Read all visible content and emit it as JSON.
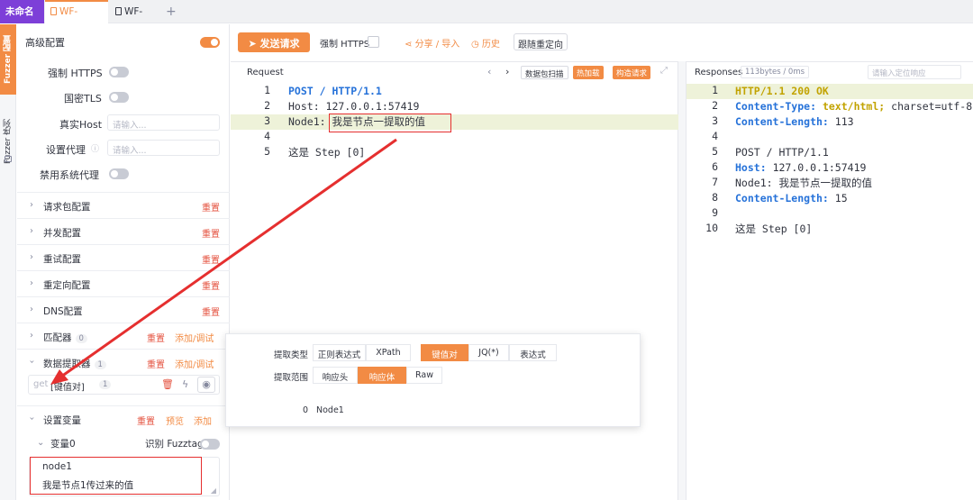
{
  "tabs": {
    "main_label": "未命名[0]",
    "wf1_label": "WF-[1]",
    "wf2_label": "WF-[2]",
    "add_label": "+"
  },
  "vertical_tabs": {
    "config_label": "Fuzzer 配置",
    "sequence_label": "Fuzzer 序列"
  },
  "config": {
    "advanced_label": "高级配置",
    "advanced_on": true,
    "force_https_label": "强制 HTTPS",
    "gm_tls_label": "国密TLS",
    "real_host_label": "真实Host",
    "real_host_placeholder": "请输入...",
    "proxy_label": "设置代理",
    "proxy_placeholder": "请输入...",
    "disable_proxy_label": "禁用系统代理",
    "sections": [
      {
        "name": "请求包配置",
        "reset": "重置"
      },
      {
        "name": "并发配置",
        "reset": "重置"
      },
      {
        "name": "重试配置",
        "reset": "重置"
      },
      {
        "name": "重定向配置",
        "reset": "重置"
      },
      {
        "name": "DNS配置",
        "reset": "重置"
      },
      {
        "name": "匹配器",
        "count": "0",
        "reset": "重置",
        "add": "添加/调试"
      },
      {
        "name": "数据提取器",
        "count": "1",
        "reset": "重置",
        "add": "添加/调试"
      }
    ],
    "extractor_item": {
      "prefix": "get",
      "name": "[键值对]",
      "count": "1"
    },
    "variables": {
      "name": "设置变量",
      "reset": "重置",
      "preview": "预览",
      "add": "添加",
      "var0_label": "变量0",
      "fuzztag_label": "识别 Fuzztag",
      "var_name": "node1",
      "var_value": "我是节点1传过来的值"
    }
  },
  "toolbar": {
    "send_label": "发送请求",
    "force_https_label": "强制 HTTPS",
    "share_label": "分享 / 导入",
    "history_label": "历史",
    "redirect_label": "跟随重定向"
  },
  "request": {
    "title": "Request",
    "btn_scan": "数据包扫描",
    "btn_hotload": "热加载",
    "btn_build": "构造请求",
    "lines": [
      {
        "n": "1",
        "text": "POST / HTTP/1.1"
      },
      {
        "n": "2",
        "text": "Host: 127.0.0.1:57419"
      },
      {
        "n": "3",
        "key": "Node1:",
        "value": "我是节点一提取的值"
      },
      {
        "n": "4",
        "text": ""
      },
      {
        "n": "5",
        "text": "这是 Step [0]"
      }
    ]
  },
  "response": {
    "title": "Responses",
    "meta": "113bytes / 0ms",
    "search_placeholder": "请输入定位响应",
    "lines": [
      {
        "n": "1",
        "text": "HTTP/1.1 200 OK"
      },
      {
        "n": "2",
        "key": "Content-Type:",
        "value": "text/html;",
        "rest": "charset=utf-8"
      },
      {
        "n": "3",
        "key": "Content-Length:",
        "value": "113"
      },
      {
        "n": "4",
        "text": ""
      },
      {
        "n": "5",
        "text": "POST / HTTP/1.1"
      },
      {
        "n": "6",
        "key": "Host:",
        "value": "127.0.0.1:57419"
      },
      {
        "n": "7",
        "text": "Node1: 我是节点一提取的值"
      },
      {
        "n": "8",
        "key": "Content-Length:",
        "value": "15"
      },
      {
        "n": "9",
        "text": ""
      },
      {
        "n": "10",
        "text": "这是 Step [0]"
      }
    ]
  },
  "popup": {
    "type_label": "提取类型",
    "types": [
      "正则表达式",
      "XPath",
      "键值对",
      "JQ(*)",
      "表达式"
    ],
    "active_type": "键值对",
    "scope_label": "提取范围",
    "scopes": [
      "响应头",
      "响应体",
      "Raw"
    ],
    "active_scope": "响应体",
    "result_index": "0",
    "result_value": "Node1"
  },
  "colors": {
    "accent": "#f28b44",
    "purple": "#7d3fd8",
    "annotation": "#e52f2f"
  }
}
